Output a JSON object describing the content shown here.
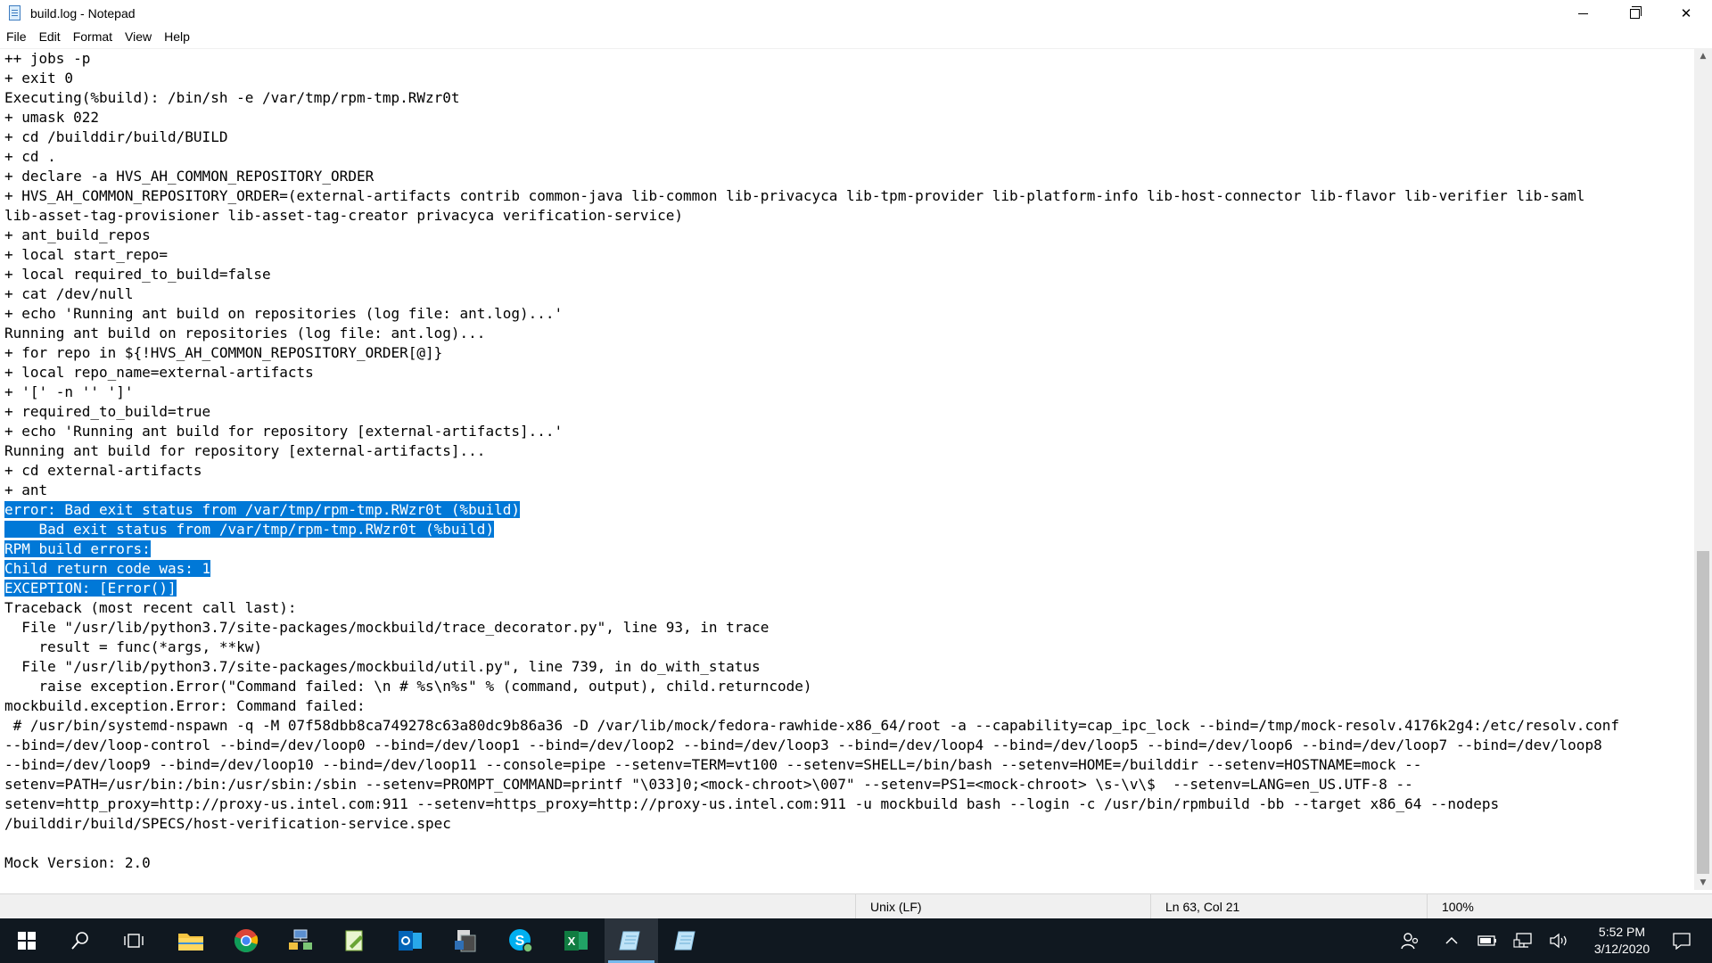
{
  "window": {
    "title": "build.log - Notepad",
    "controls": {
      "minimize": "minimize",
      "maximize": "restore",
      "close": "✕"
    }
  },
  "menu": [
    "File",
    "Edit",
    "Format",
    "View",
    "Help"
  ],
  "editor": {
    "lines": [
      "++ jobs -p",
      "+ exit 0",
      "Executing(%build): /bin/sh -e /var/tmp/rpm-tmp.RWzr0t",
      "+ umask 022",
      "+ cd /builddir/build/BUILD",
      "+ cd .",
      "+ declare -a HVS_AH_COMMON_REPOSITORY_ORDER",
      "+ HVS_AH_COMMON_REPOSITORY_ORDER=(external-artifacts contrib common-java lib-common lib-privacyca lib-tpm-provider lib-platform-info lib-host-connector lib-flavor lib-verifier lib-saml",
      "lib-asset-tag-provisioner lib-asset-tag-creator privacyca verification-service)",
      "+ ant_build_repos",
      "+ local start_repo=",
      "+ local required_to_build=false",
      "+ cat /dev/null",
      "+ echo 'Running ant build on repositories (log file: ant.log)...'",
      "Running ant build on repositories (log file: ant.log)...",
      "+ for repo in ${!HVS_AH_COMMON_REPOSITORY_ORDER[@]}",
      "+ local repo_name=external-artifacts",
      "+ '[' -n '' ']'",
      "+ required_to_build=true",
      "+ echo 'Running ant build for repository [external-artifacts]...'",
      "Running ant build for repository [external-artifacts]...",
      "+ cd external-artifacts",
      "+ ant",
      "error: Bad exit status from /var/tmp/rpm-tmp.RWzr0t (%build)",
      "    Bad exit status from /var/tmp/rpm-tmp.RWzr0t (%build)",
      "RPM build errors:",
      "Child return code was: 1",
      "EXCEPTION: [Error()]",
      "Traceback (most recent call last):",
      "  File \"/usr/lib/python3.7/site-packages/mockbuild/trace_decorator.py\", line 93, in trace",
      "    result = func(*args, **kw)",
      "  File \"/usr/lib/python3.7/site-packages/mockbuild/util.py\", line 739, in do_with_status",
      "    raise exception.Error(\"Command failed: \\n # %s\\n%s\" % (command, output), child.returncode)",
      "mockbuild.exception.Error: Command failed:",
      " # /usr/bin/systemd-nspawn -q -M 07f58dbb8ca749278c63a80dc9b86a36 -D /var/lib/mock/fedora-rawhide-x86_64/root -a --capability=cap_ipc_lock --bind=/tmp/mock-resolv.4176k2g4:/etc/resolv.conf",
      "--bind=/dev/loop-control --bind=/dev/loop0 --bind=/dev/loop1 --bind=/dev/loop2 --bind=/dev/loop3 --bind=/dev/loop4 --bind=/dev/loop5 --bind=/dev/loop6 --bind=/dev/loop7 --bind=/dev/loop8",
      "--bind=/dev/loop9 --bind=/dev/loop10 --bind=/dev/loop11 --console=pipe --setenv=TERM=vt100 --setenv=SHELL=/bin/bash --setenv=HOME=/builddir --setenv=HOSTNAME=mock --",
      "setenv=PATH=/usr/bin:/bin:/usr/sbin:/sbin --setenv=PROMPT_COMMAND=printf \"\\033]0;<mock-chroot>\\007\" --setenv=PS1=<mock-chroot> \\s-\\v\\$  --setenv=LANG=en_US.UTF-8 --",
      "setenv=http_proxy=http://proxy-us.intel.com:911 --setenv=https_proxy=http://proxy-us.intel.com:911 -u mockbuild bash --login -c /usr/bin/rpmbuild -bb --target x86_64 --nodeps",
      "/builddir/build/SPECS/host-verification-service.spec",
      "",
      "Mock Version: 2.0"
    ],
    "selected_lines": [
      23,
      24,
      25,
      26,
      27
    ]
  },
  "status": {
    "line_ending": "Unix (LF)",
    "position": "Ln 63, Col 21",
    "zoom": "100%"
  },
  "taskbar": {
    "apps": [
      "windows-start",
      "search",
      "task-view",
      "file-explorer",
      "chrome",
      "network-app",
      "notepad-plus",
      "outlook",
      "documents-app",
      "skype",
      "excel",
      "notepad-active",
      "notepad"
    ],
    "clock": {
      "time": "5:52 PM",
      "date": "3/12/2020"
    }
  }
}
